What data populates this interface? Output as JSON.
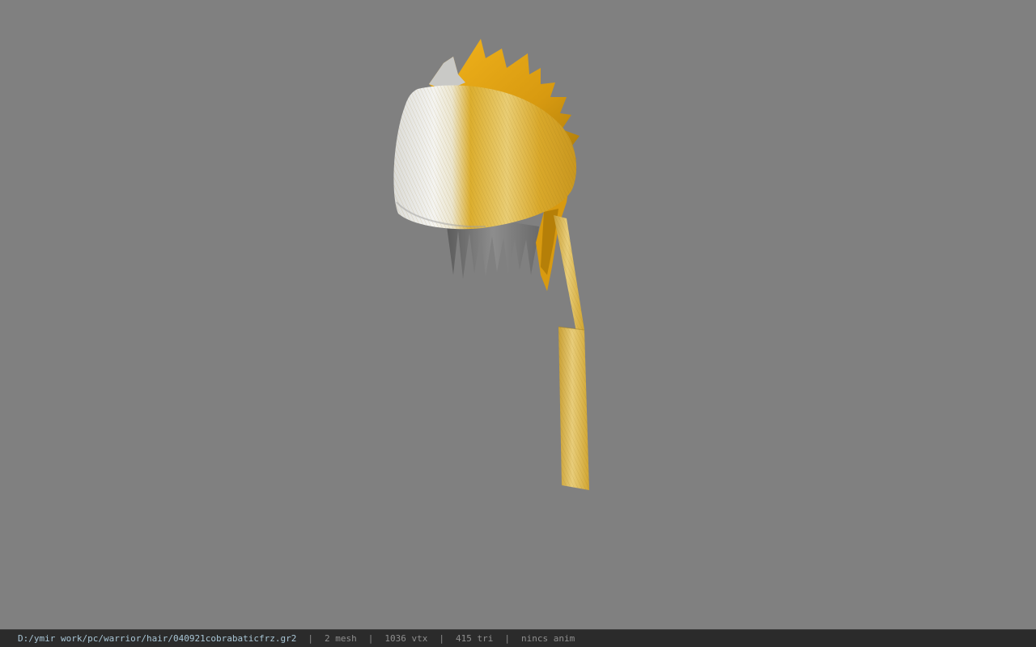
{
  "viewer": {
    "background_color": "#808080",
    "model_colors": {
      "gold": "#e2a61c",
      "gold_dark": "#b9820c",
      "cloth_white": "#f1f1ee",
      "cloth_gold": "#dcae2e",
      "shadow_gray": "#6e6e6e"
    }
  },
  "statusbar": {
    "file_path": "D:/ymir work/pc/warrior/hair/040921cobrabaticfrz.gr2",
    "separator": "|",
    "mesh_count": "2 mesh",
    "vertex_count": "1036 vtx",
    "triangle_count": "415 tri",
    "anim_status": "nincs anim"
  }
}
